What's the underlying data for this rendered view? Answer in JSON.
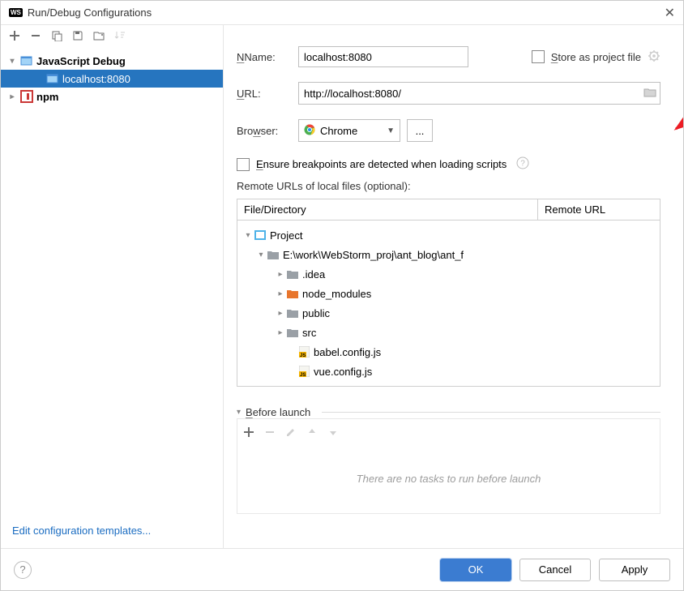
{
  "window": {
    "title": "Run/Debug Configurations"
  },
  "sidebar": {
    "categories": [
      {
        "label": "JavaScript Debug",
        "expanded": true,
        "selected_child": "localhost:8080"
      },
      {
        "label": "npm",
        "expanded": false
      }
    ],
    "templates_link": "Edit configuration templates..."
  },
  "form": {
    "name_label": "Name:",
    "name_value": "localhost:8080",
    "store_as_project": "Store as project file",
    "url_label": "URL:",
    "url_value": "http://localhost:8080/",
    "browser_label": "Browser:",
    "browser_value": "Chrome",
    "ensure_breakpoints": "Ensure breakpoints are detected when loading scripts",
    "remote_urls_label": "Remote URLs of local files (optional):",
    "file_table": {
      "col1": "File/Directory",
      "col2": "Remote URL",
      "root": "Project",
      "path": "E:\\work\\WebStorm_proj\\ant_blog\\ant_f",
      "items": [
        {
          "name": ".idea",
          "type": "folder",
          "color": "#9aa0a6",
          "expandable": true
        },
        {
          "name": "node_modules",
          "type": "folder",
          "color": "#e8762d",
          "expandable": true
        },
        {
          "name": "public",
          "type": "folder",
          "color": "#9aa0a6",
          "expandable": true
        },
        {
          "name": "src",
          "type": "folder",
          "color": "#9aa0a6",
          "expandable": true
        },
        {
          "name": "babel.config.js",
          "type": "jsfile"
        },
        {
          "name": "vue.config.js",
          "type": "jsfile"
        }
      ]
    },
    "before_launch": {
      "label": "Before launch",
      "empty": "There are no tasks to run before launch"
    }
  },
  "footer": {
    "ok": "OK",
    "cancel": "Cancel",
    "apply": "Apply"
  }
}
